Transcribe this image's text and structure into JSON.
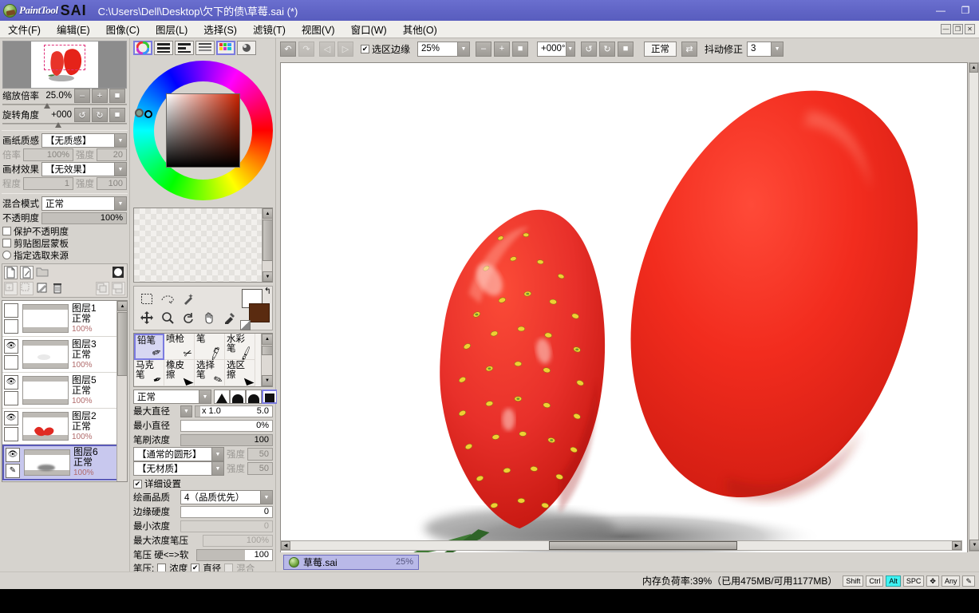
{
  "app": {
    "brand_painttool": "PaintTool",
    "brand_sai": "SAI",
    "title_path": "C:\\Users\\Dell\\Desktop\\欠下的债\\草莓.sai (*)",
    "accent_title_bg": "#6165c6",
    "panel_bg": "#d6d3ce",
    "selection_blue": "#7b7be0"
  },
  "window_buttons": {
    "minimize": "—",
    "restore": "❐",
    "close": "✕"
  },
  "menu": {
    "items": [
      {
        "label": "文件(F)"
      },
      {
        "label": "编辑(E)"
      },
      {
        "label": "图像(C)"
      },
      {
        "label": "图层(L)"
      },
      {
        "label": "选择(S)"
      },
      {
        "label": "滤镜(T)"
      },
      {
        "label": "视图(V)"
      },
      {
        "label": "窗口(W)"
      },
      {
        "label": "其他(O)"
      }
    ]
  },
  "navigator": {
    "zoom_label": "缩放倍率",
    "zoom_value": "25.0%",
    "rotate_label": "旋转角度",
    "rotate_value": "+000",
    "btn_zoom_out": "–",
    "btn_zoom_in": "+",
    "btn_zoom_reset": "■",
    "btn_rot_ccw": "↺",
    "btn_rot_cw": "↻",
    "btn_rot_reset": "■"
  },
  "paper": {
    "texture_label": "画纸质感",
    "texture_value": "【无质感】",
    "scale_label": "倍率",
    "scale_value": "100%",
    "strength_label": "强度",
    "strength_value": "20",
    "effect_label": "画材效果",
    "effect_value": "【无效果】",
    "degree_label": "程度",
    "degree_value": "1",
    "effect_strength_label": "强度",
    "effect_strength_value": "100"
  },
  "layer_props": {
    "blend_label": "混合模式",
    "blend_value": "正常",
    "opacity_label": "不透明度",
    "opacity_value": "100%",
    "protect_alpha": "保护不透明度",
    "clipping_mask": "剪贴图层蒙板",
    "select_source": "指定选取来源"
  },
  "layer_toolbar": {
    "new_layer": "new-layer",
    "new_linework": "new-linework-layer",
    "new_folder": "new-folder",
    "mask": "layer-mask",
    "merge_down": "merge-down",
    "merge_visible": "merge-visible",
    "clear": "clear-layer",
    "delete": "delete-layer",
    "duplicate": "duplicate-layer",
    "transfer": "transfer-layer"
  },
  "layers": [
    {
      "name": "图层1",
      "mode": "正常",
      "opacity": "100%",
      "visible": false,
      "selected": false,
      "thumb": "blank"
    },
    {
      "name": "图层3",
      "mode": "正常",
      "opacity": "100%",
      "visible": true,
      "selected": false,
      "thumb": "faint"
    },
    {
      "name": "图层5",
      "mode": "正常",
      "opacity": "100%",
      "visible": true,
      "selected": false,
      "thumb": "blank"
    },
    {
      "name": "图层2",
      "mode": "正常",
      "opacity": "100%",
      "visible": true,
      "selected": false,
      "thumb": "red-mark"
    },
    {
      "name": "图层6",
      "mode": "正常",
      "opacity": "100%",
      "visible": true,
      "selected": true,
      "thumb": "shadow"
    }
  ],
  "color_tabs": [
    {
      "name": "color-wheel-tab",
      "active": true
    },
    {
      "name": "rgb-slider-tab",
      "active": false
    },
    {
      "name": "hsv-slider-tab",
      "active": false
    },
    {
      "name": "color-mixer-tab",
      "active": false
    },
    {
      "name": "swatches-tab",
      "active": true
    },
    {
      "name": "scratchpad-tab",
      "active": false
    }
  ],
  "tool_top": {
    "icons": [
      {
        "name": "rect-select-icon",
        "glyph": "▢"
      },
      {
        "name": "lasso-select-icon",
        "glyph": "༄"
      },
      {
        "name": "magic-wand-icon",
        "glyph": "✧"
      },
      {
        "name": "move-icon",
        "glyph": "✥"
      },
      {
        "name": "zoom-icon",
        "glyph": "⌕"
      },
      {
        "name": "rotate-icon",
        "glyph": "↻"
      },
      {
        "name": "hand-icon",
        "glyph": "✋"
      },
      {
        "name": "eyedropper-icon",
        "glyph": "✎"
      }
    ],
    "fg_color": "#ffffff",
    "bg_color": "#5a2b10"
  },
  "brushes": [
    {
      "label": "铅笔",
      "selected": true
    },
    {
      "label": "喷枪",
      "selected": false
    },
    {
      "label": "笔",
      "selected": false
    },
    {
      "label": "水彩笔",
      "selected": false
    },
    {
      "label": "马克笔",
      "selected": false
    },
    {
      "label": "橡皮擦",
      "selected": false
    },
    {
      "label": "选择笔",
      "selected": false
    },
    {
      "label": "选区擦",
      "selected": false
    }
  ],
  "brush_settings": {
    "blend_mode": "正常",
    "max_diameter_label": "最大直径",
    "max_diameter_mult": "x 1.0",
    "max_diameter_value": "5.0",
    "min_diameter_label": "最小直径",
    "min_diameter_value": "0%",
    "density_label": "笔刷浓度",
    "density_value": "100",
    "shape_label": "【通常的圆形】",
    "shape_strength_label": "强度",
    "shape_strength_value": "50",
    "material_label": "【无材质】",
    "material_strength_label": "强度",
    "material_strength_value": "50",
    "detail_settings": "详细设置",
    "quality_label": "绘画品质",
    "quality_value": "4（品质优先）",
    "edge_hard_label": "边缘硬度",
    "edge_hard_value": "0",
    "min_density_label": "最小浓度",
    "min_density_value": "0",
    "max_density_pressure_label": "最大浓度笔压",
    "max_density_pressure_value": "100%",
    "pressure_label": "笔压 硬<=>软",
    "pressure_value": "100",
    "pressure_row_label": "笔压:",
    "pressure_density": "浓度",
    "pressure_diameter": "直径",
    "pressure_blend": "混合"
  },
  "canvas_toolbar": {
    "undo": "↶",
    "redo": "↷",
    "nav_prev": "◁",
    "nav_next": "▷",
    "sel_edge_label": "选区边缘",
    "sel_edge_checked": true,
    "zoom_value": "25%",
    "zoom_out": "–",
    "zoom_in": "+",
    "zoom_reset": "■",
    "rotation_value": "+000°",
    "rot_ccw": "↺",
    "rot_cw": "↻",
    "rot_reset": "■",
    "mode_value": "正常",
    "flip_icon": "⇄",
    "stabilizer_label": "抖动修正",
    "stabilizer_value": "3"
  },
  "document_tab": {
    "name": "草莓.sai",
    "zoom": "25%"
  },
  "status": {
    "memory": "内存负荷率:39%（已用475MB/可用1177MB）",
    "keys": [
      {
        "label": "Shift",
        "active": false
      },
      {
        "label": "Ctrl",
        "active": false
      },
      {
        "label": "Alt",
        "active": true
      },
      {
        "label": "SPC",
        "active": false
      }
    ],
    "dpad": "✥",
    "any_label": "Any",
    "pen_icon": "✎"
  },
  "artwork": {
    "title": "two-strawberries-painting",
    "background": "#ffffff",
    "left_berry_color": "#e8342a",
    "right_berry_color": "#e52319",
    "seed_color": "#f2d33a",
    "leaf_color": "#3f7a35",
    "shadow_color": "#6b6b6b"
  }
}
